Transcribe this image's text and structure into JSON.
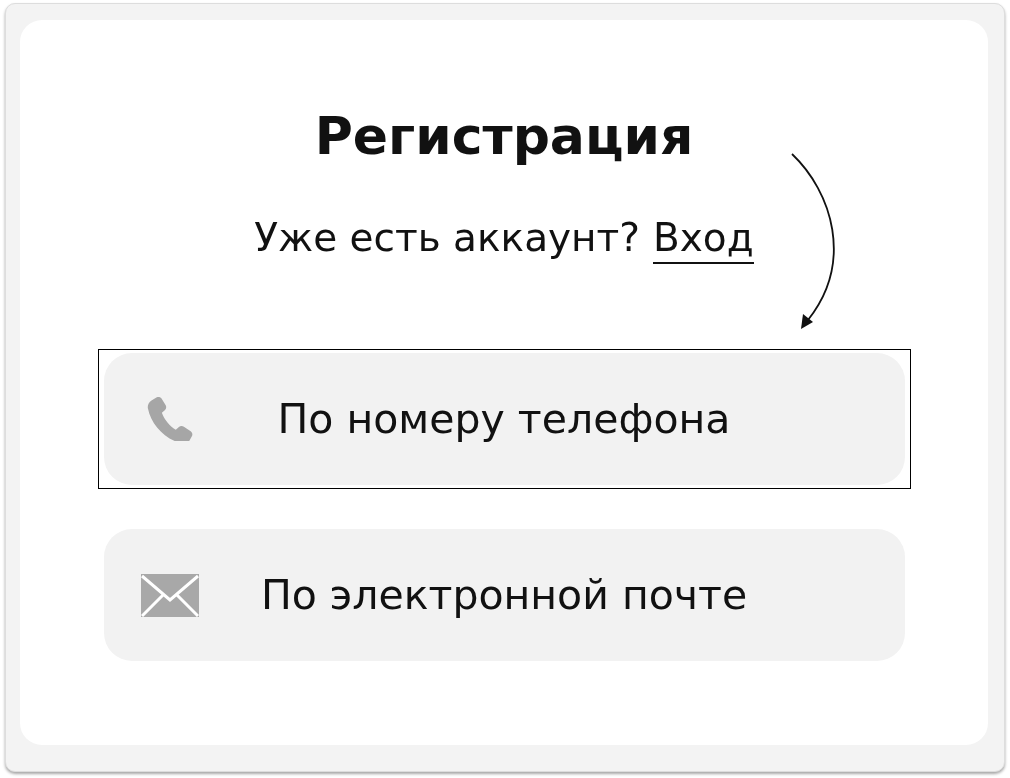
{
  "title": "Регистрация",
  "login_prompt": {
    "text": "Уже есть аккаунт?",
    "link": "Вход"
  },
  "options": [
    {
      "kind": "phone",
      "label": "По номеру телефона",
      "highlighted": true
    },
    {
      "kind": "email",
      "label": "По электронной почте",
      "highlighted": false
    }
  ]
}
